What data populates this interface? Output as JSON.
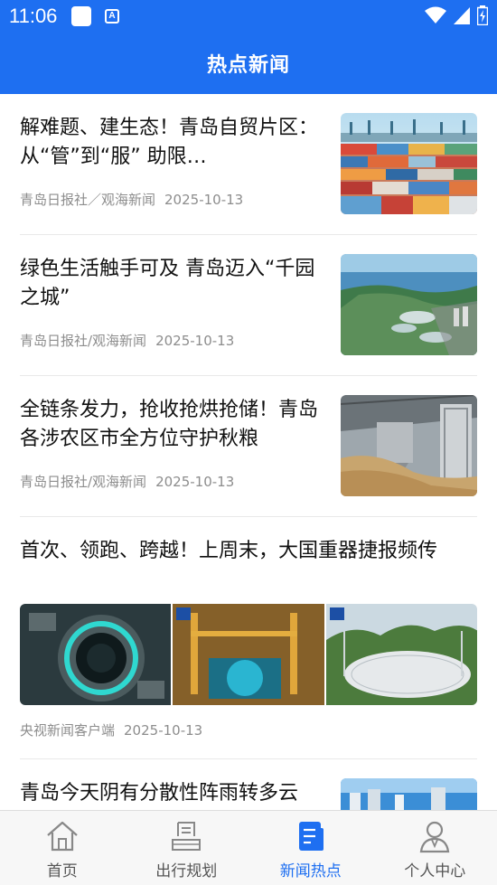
{
  "status_bar": {
    "time": "11:06",
    "app_icon_letter": "A"
  },
  "header": {
    "title": "热点新闻"
  },
  "news": [
    {
      "title": "解难题、建生态！青岛自贸片区：从“管”到“服” 助限…",
      "source": "青岛日报社／观海新闻",
      "date": "2025-10-13",
      "image": "container-port"
    },
    {
      "title": "绿色生活触手可及 青岛迈入“千园之城”",
      "source": "青岛日报社/观海新闻",
      "date": "2025-10-13",
      "image": "coastal-park"
    },
    {
      "title": "全链条发力，抢收抢烘抢储！青岛各涉农区市全方位守护秋粮",
      "source": "青岛日报社/观海新闻",
      "date": "2025-10-13",
      "image": "grain-dryer"
    },
    {
      "title": "首次、领跑、跨越！上周末，大国重器捷报频传",
      "source": "央视新闻客户端",
      "date": "2025-10-13",
      "images": [
        "reactor-ring",
        "reactor-core",
        "radio-telescope"
      ]
    },
    {
      "title": "青岛今天阴有分散性阵雨转多云",
      "image": "city-skyline"
    }
  ],
  "bottom_nav": [
    {
      "label": "首页",
      "icon": "home-icon",
      "active": false
    },
    {
      "label": "出行规划",
      "icon": "route-icon",
      "active": false
    },
    {
      "label": "新闻热点",
      "icon": "news-icon",
      "active": true
    },
    {
      "label": "个人中心",
      "icon": "user-icon",
      "active": false
    }
  ],
  "colors": {
    "primary": "#1e6ff1",
    "meta_text": "#8d8d8d",
    "nav_bg": "#f7f7f7"
  }
}
